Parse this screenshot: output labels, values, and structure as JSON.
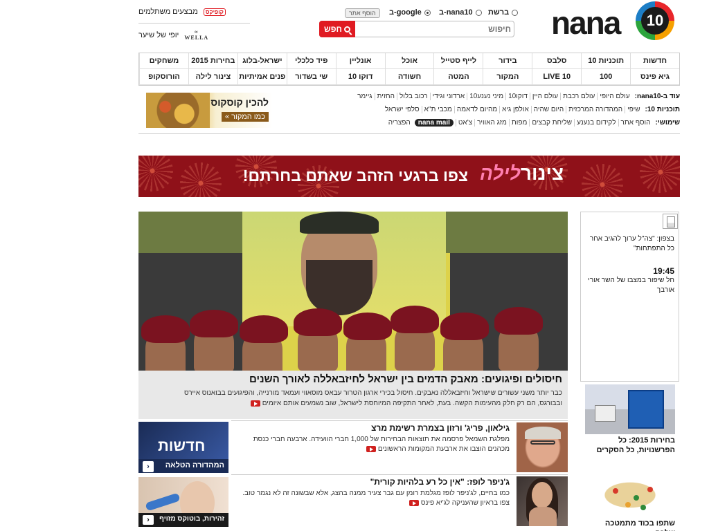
{
  "logo": {
    "word": "nana",
    "number": "10"
  },
  "search_scope": {
    "options": [
      {
        "label": "ברשת",
        "selected": false
      },
      {
        "label": "ב-nana10",
        "selected": false
      },
      {
        "label": "ב-google",
        "selected": true
      }
    ],
    "extra_button": "הוסף אתר"
  },
  "search": {
    "placeholder": "חיפוש",
    "value": "",
    "button": "חפש"
  },
  "promos": [
    {
      "logo": "קופיקס",
      "text": "מבצעים משתלמים"
    },
    {
      "logo": "WELLA",
      "text": "יופי של שיער"
    }
  ],
  "nav": {
    "row1": [
      "חדשות",
      "תוכניות 10",
      "סלבס",
      "בידור",
      "לייף סטייל",
      "אוכל",
      "אונליין",
      "פיד כלכלי",
      "ישראל-בלוג",
      "בחירות 2015",
      "משחקים"
    ],
    "row2": [
      "גיא פינס",
      "100",
      "LIVE 10",
      "המקור",
      "המטה",
      "חשודה",
      "דוקו 10",
      "שי בשדור",
      "פנים אמיתיות",
      "צינור לילה",
      "הורוסקופ"
    ]
  },
  "quicklinks": {
    "row1": {
      "label": "עוד ב-nana10:",
      "links": [
        "עולם היופי",
        "עולם רכבת",
        "עולם היין",
        "דוקו10",
        "מיני נענע10",
        "ארדוני וגידי",
        "רכוב בלול",
        "החזית",
        "גיימר"
      ]
    },
    "row2": {
      "label": "תוכניות 10:",
      "links": [
        "שיפי",
        "המהדורה המרכזית",
        "היום שהיה",
        "אולפן גיא",
        "מהיום לדאמה",
        "מכבי ת\"א",
        "סלפי ישראל"
      ]
    },
    "row3": {
      "label": "שימושי:",
      "links": [
        "הוסף אתר",
        "לקידום בנענע",
        "שליחת קבצים",
        "מפות",
        "מזג האוויר",
        "צ'אט",
        "nana mail",
        "הפצריה"
      ]
    }
  },
  "ad": {
    "line1": "להכין קוסקוס",
    "line2": "כמו המקור »"
  },
  "banner": {
    "brand1": "צינור",
    "brand2": "לילה",
    "tagline": "צפו ברגעי הזהב שאתם בחרתם!"
  },
  "hero": {
    "headline": "חיסולים ופיגועים: מאבק הדמים בין ישראל לחיזבאללה לאורך השנים",
    "line1": "כבר יותר משני עשורים שישראל וחיזבאללה נאבקים. חיסול בכירי ארגון הטרור עבאס מוסאווי ועמאד מורנייה, והפיגועים בבואנוס איירס",
    "line2": "ובבורגס, הם רק חלק מהעימות הקשה. בעת, לאחר התקיפה המיוחסת לישראל, שוב נשמעים אותם איומים"
  },
  "right_col": {
    "item1": "בצפון: \"צה\"ל ערוך להגיב אחר כל התפתחות\"",
    "item2_time": "19:45",
    "item2": "חל שיפור במצבו של השר אורי אורבך"
  },
  "right_photos": [
    {
      "caption": "בחירות 2015: כל הפרשנויות, כל הסקרים"
    },
    {
      "caption": "שתפו בכוד מתמטכה שלכם"
    }
  ],
  "thumbs": [
    {
      "title": "חדשות",
      "label": "המהדורה הטלאה",
      "arrow": "‹"
    },
    {
      "label": "זהירות, בוטוקס מזויף",
      "arrow": "‹"
    }
  ],
  "articles": [
    {
      "title": "גילאון, פריג' ורזון בצמרת רשימת מרצ",
      "desc": "מפלגת השמאל פרסמה את תוצאות הבחירות של 1,000 חברי הוועידה. ארבעה חברי כנסת מכהנים הוצבו את ארבעת המקומות הראשונים"
    },
    {
      "title": "ג'ניפר לופז: \"אין כל רע בלהיות קורית\"",
      "desc": "כמו בחיים, לג'ניפר לופז מגלמת רומן עם גבר צעיר ממנה בהצג, אלא שבשונה זה לא נגמר טוב. צפו בראיון שהעניקה לג'יא פינס"
    }
  ]
}
